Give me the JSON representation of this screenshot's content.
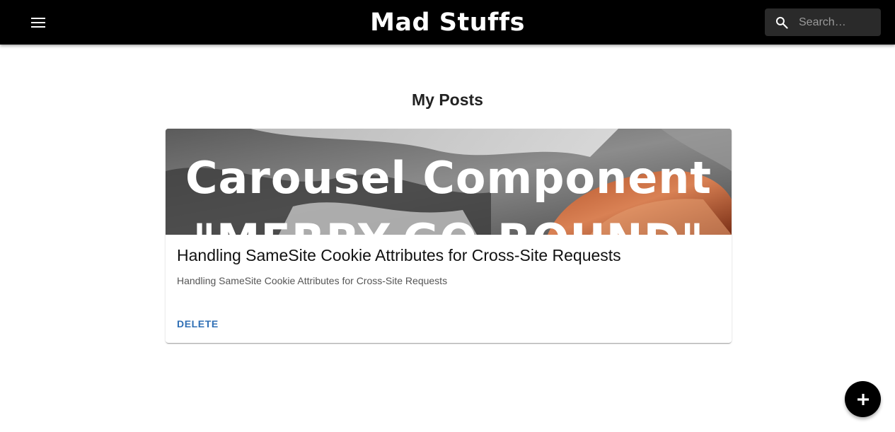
{
  "appbar": {
    "title": "Mad Stuffs",
    "menu_icon": "menu-icon",
    "search": {
      "placeholder": "Search…",
      "value": "",
      "icon": "search-icon"
    }
  },
  "main": {
    "heading": "My Posts",
    "posts": [
      {
        "image_text": [
          "Carousel Component",
          "\"MERRY-GO-ROUND\""
        ],
        "title": "Handling SameSite Cookie Attributes for Cross-Site Requests",
        "summary": "Handling SameSite Cookie Attributes for Cross-Site Requests",
        "action_label": "DELETE"
      }
    ]
  },
  "fab": {
    "icon": "add-icon"
  },
  "colors": {
    "appbar_bg": "#000000",
    "action_blue": "#2f6fb5",
    "fab_bg": "#000000"
  }
}
